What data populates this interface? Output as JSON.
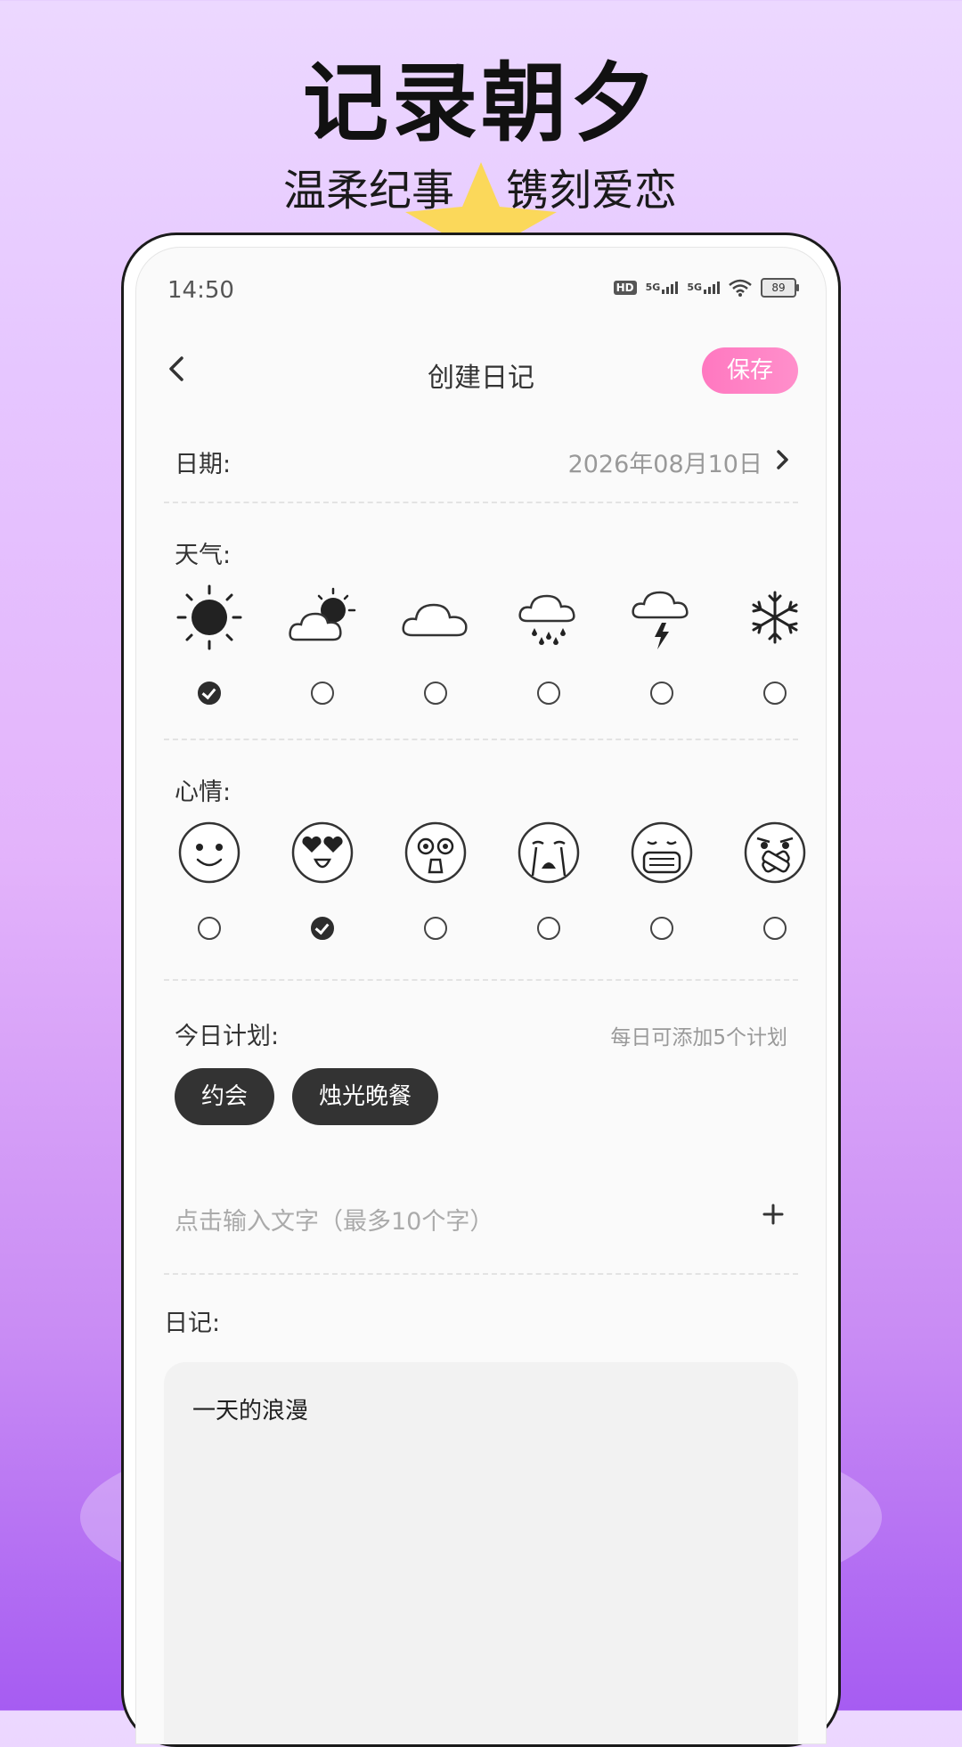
{
  "hero": {
    "title": "记录朝夕",
    "subtitle_left": "温柔纪事",
    "subtitle_right": "镌刻爱恋"
  },
  "status_bar": {
    "time": "14:50",
    "network_1": "5G",
    "network_2": "5G",
    "hd": "HD",
    "battery": "89"
  },
  "nav": {
    "title": "创建日记",
    "save_label": "保存",
    "back_icon": "chevron-left-icon"
  },
  "date": {
    "label": "日期:",
    "value": "2026年08月10日"
  },
  "weather": {
    "label": "天气:",
    "options": [
      {
        "icon": "sunny-icon",
        "selected": true
      },
      {
        "icon": "partly-cloudy-icon",
        "selected": false
      },
      {
        "icon": "cloudy-icon",
        "selected": false
      },
      {
        "icon": "rain-icon",
        "selected": false
      },
      {
        "icon": "thunderstorm-icon",
        "selected": false
      },
      {
        "icon": "snow-icon",
        "selected": false
      }
    ]
  },
  "mood": {
    "label": "心情:",
    "options": [
      {
        "icon": "smile-face-icon",
        "selected": false
      },
      {
        "icon": "heart-eyes-face-icon",
        "selected": true
      },
      {
        "icon": "shocked-face-icon",
        "selected": false
      },
      {
        "icon": "crying-face-icon",
        "selected": false
      },
      {
        "icon": "mask-face-icon",
        "selected": false
      },
      {
        "icon": "bandaged-face-icon",
        "selected": false
      }
    ]
  },
  "plan": {
    "label": "今日计划:",
    "hint": "每日可添加5个计划",
    "items": [
      "约会",
      "烛光晚餐"
    ],
    "input_placeholder": "点击输入文字（最多10个字）"
  },
  "diary": {
    "label": "日记:",
    "content": "一天的浪漫"
  },
  "colors": {
    "accent_pink": "#ff7fc4",
    "chip_dark": "#333333",
    "star_yellow": "#fbd85a"
  }
}
